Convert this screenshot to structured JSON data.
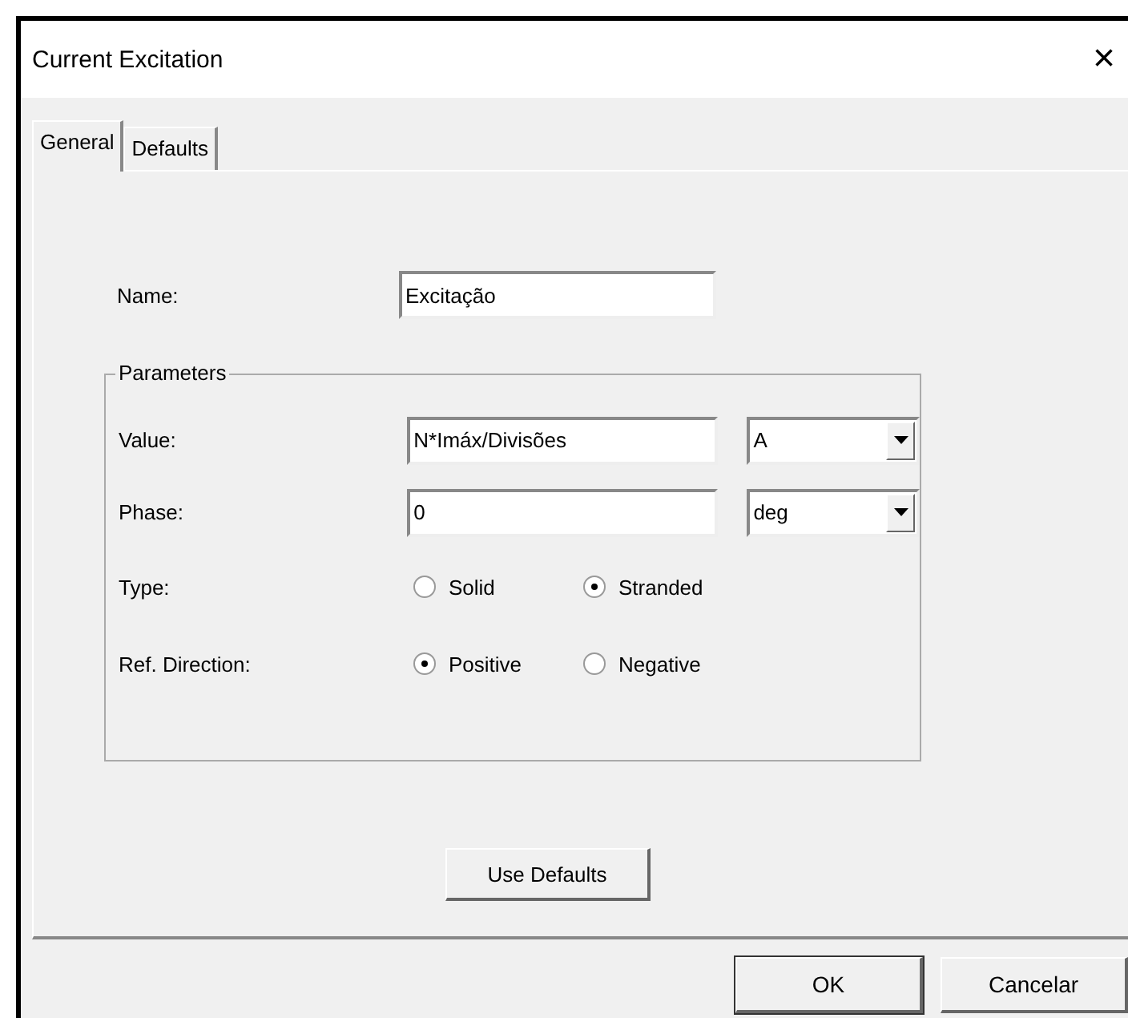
{
  "window": {
    "title": "Current Excitation",
    "close": "×"
  },
  "tabs": [
    {
      "label": "General",
      "selected": true
    },
    {
      "label": "Defaults",
      "selected": false
    }
  ],
  "name": {
    "label": "Name:",
    "value": "Excitação"
  },
  "parameters": {
    "title": "Parameters",
    "value": {
      "label": "Value:",
      "value": "N*Imáx/Divisões",
      "unit": "A"
    },
    "phase": {
      "label": "Phase:",
      "value": "0",
      "unit": "deg"
    },
    "type": {
      "label": "Type:",
      "options": [
        {
          "label": "Solid",
          "selected": false
        },
        {
          "label": "Stranded",
          "selected": true
        }
      ]
    },
    "ref_direction": {
      "label": "Ref. Direction:",
      "options": [
        {
          "label": "Positive",
          "selected": true
        },
        {
          "label": "Negative",
          "selected": false
        }
      ]
    }
  },
  "use_defaults_button": "Use Defaults",
  "buttons": [
    "OK",
    "Cancelar"
  ]
}
